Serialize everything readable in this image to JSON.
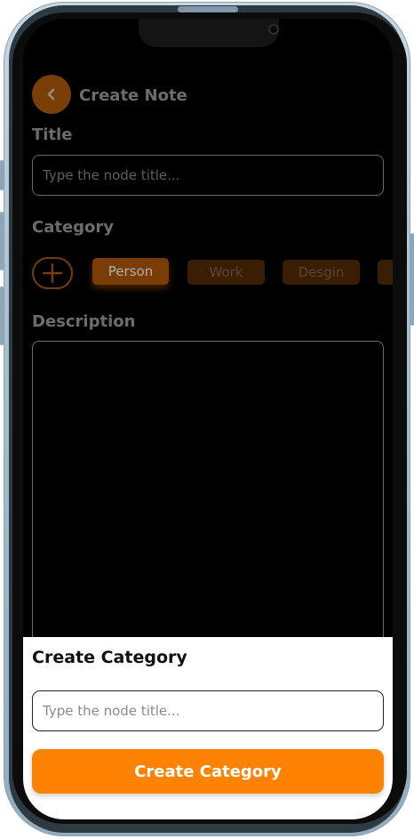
{
  "header": {
    "title": "Create Note"
  },
  "title_section": {
    "label": "Title",
    "input_placeholder": "Type the node title...",
    "input_value": ""
  },
  "category_section": {
    "label": "Category",
    "chips": [
      {
        "label": "Person",
        "selected": true
      },
      {
        "label": "Work",
        "selected": false
      },
      {
        "label": "Desgin",
        "selected": false
      }
    ]
  },
  "description_section": {
    "label": "Description",
    "value": ""
  },
  "bottom_sheet": {
    "title": "Create Category",
    "input_placeholder": "Type the node title...",
    "input_value": "",
    "submit_label": "Create Category"
  },
  "icons": {
    "back": "chevron-left-icon",
    "add_category": "plus-icon"
  },
  "colors": {
    "accent": "#ff8300",
    "accent_dimmed": "#7a3d05",
    "screen_background": "#000000",
    "sheet_background": "#ffffff"
  }
}
